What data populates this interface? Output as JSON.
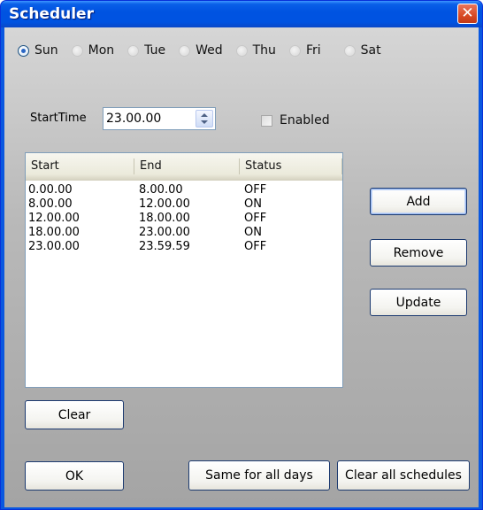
{
  "window": {
    "title": "Scheduler"
  },
  "days": [
    {
      "label": "Sun",
      "checked": true
    },
    {
      "label": "Mon",
      "checked": false
    },
    {
      "label": "Tue",
      "checked": false
    },
    {
      "label": "Wed",
      "checked": false
    },
    {
      "label": "Thu",
      "checked": false
    },
    {
      "label": "Fri",
      "checked": false
    },
    {
      "label": "Sat",
      "checked": false
    }
  ],
  "start_time": {
    "label": "StartTime",
    "value": "23.00.00"
  },
  "enabled": {
    "label": "Enabled",
    "checked": false
  },
  "list": {
    "columns": [
      "Start",
      "End",
      "Status"
    ],
    "rows": [
      [
        "0.00.00",
        "8.00.00",
        "OFF"
      ],
      [
        "8.00.00",
        "12.00.00",
        "ON"
      ],
      [
        "12.00.00",
        "18.00.00",
        "OFF"
      ],
      [
        "18.00.00",
        "23.00.00",
        "ON"
      ],
      [
        "23.00.00",
        "23.59.59",
        "OFF"
      ]
    ]
  },
  "buttons": {
    "add": "Add",
    "remove": "Remove",
    "update": "Update",
    "clear": "Clear",
    "ok": "OK",
    "same_all_days": "Same for all days",
    "clear_all": "Clear all schedules"
  }
}
